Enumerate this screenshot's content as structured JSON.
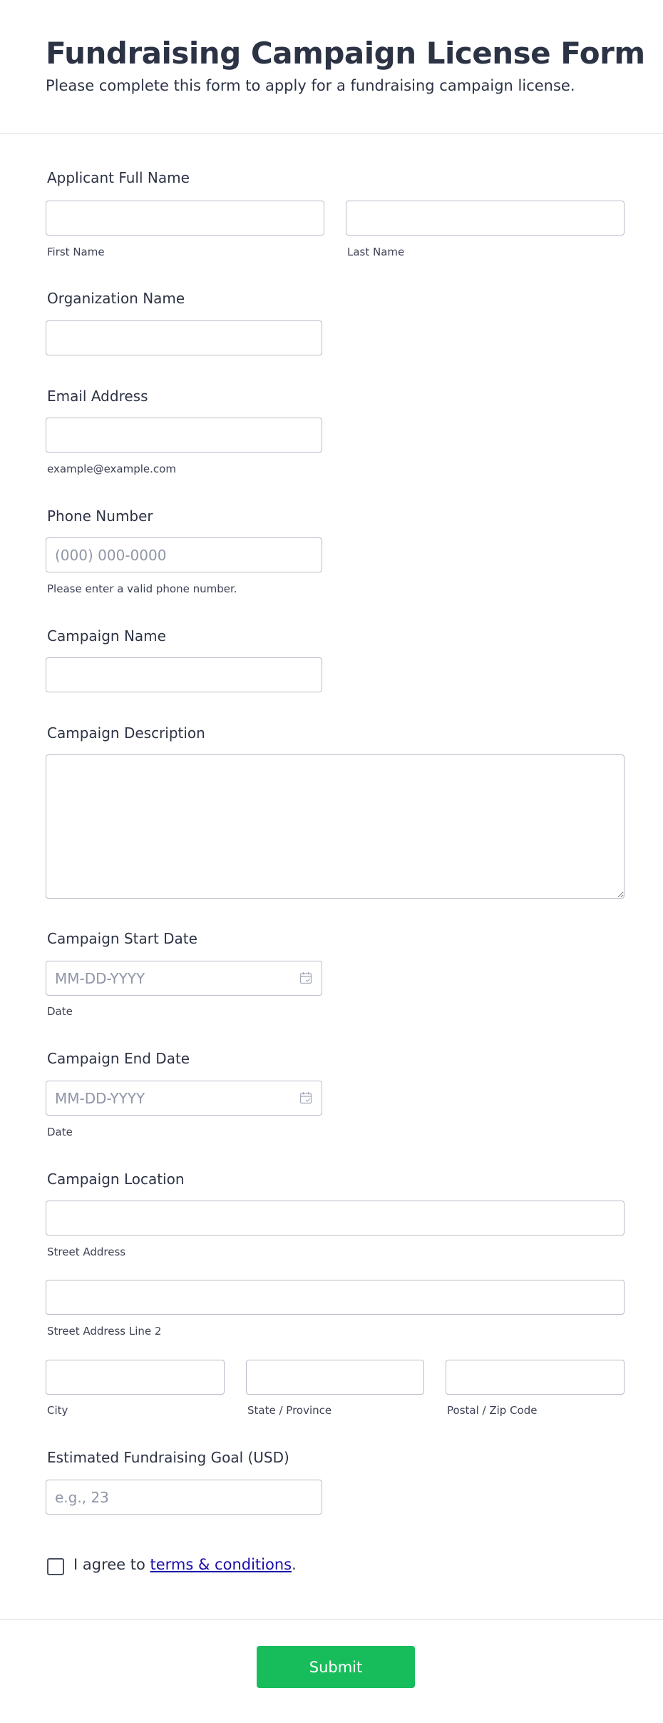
{
  "header": {
    "title": "Fundraising Campaign License Form",
    "subtitle": "Please complete this form to apply for a fundraising campaign license."
  },
  "fields": {
    "full_name": {
      "label": "Applicant Full Name",
      "first_sublabel": "First Name",
      "last_sublabel": "Last Name",
      "first_value": "",
      "last_value": ""
    },
    "organization": {
      "label": "Organization Name",
      "value": ""
    },
    "email": {
      "label": "Email Address",
      "sublabel": "example@example.com",
      "value": ""
    },
    "phone": {
      "label": "Phone Number",
      "placeholder": "(000) 000-0000",
      "sublabel": "Please enter a valid phone number.",
      "value": ""
    },
    "campaign_name": {
      "label": "Campaign Name",
      "value": ""
    },
    "campaign_description": {
      "label": "Campaign Description",
      "value": ""
    },
    "start_date": {
      "label": "Campaign Start Date",
      "placeholder": "MM-DD-YYYY",
      "sublabel": "Date",
      "icon": "calendar-icon"
    },
    "end_date": {
      "label": "Campaign End Date",
      "placeholder": "MM-DD-YYYY",
      "sublabel": "Date",
      "icon": "calendar-icon"
    },
    "location": {
      "label": "Campaign Location",
      "street_sublabel": "Street Address",
      "street2_sublabel": "Street Address Line 2",
      "city_sublabel": "City",
      "state_sublabel": "State / Province",
      "postal_sublabel": "Postal / Zip Code"
    },
    "goal": {
      "label": "Estimated Fundraising Goal (USD)",
      "placeholder": "e.g., 23",
      "value": ""
    }
  },
  "agreement": {
    "prefix": "I agree to ",
    "link_text": "terms & conditions",
    "suffix": ".",
    "checked": false
  },
  "submit": {
    "label": "Submit"
  },
  "colors": {
    "text": "#2c3345",
    "border": "#b8bdc9",
    "placeholder": "#8f96a8",
    "submit_bg": "#18bd5b",
    "link": "#1a0dab"
  }
}
